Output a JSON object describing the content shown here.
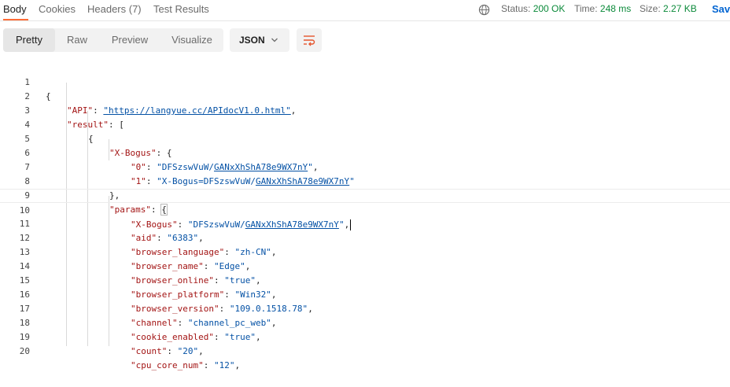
{
  "tabs": [
    {
      "label": "Body"
    },
    {
      "label": "Cookies"
    },
    {
      "label": "Headers (7)"
    },
    {
      "label": "Test Results"
    }
  ],
  "status": {
    "status_label": "Status:",
    "status_value": "200 OK",
    "time_label": "Time:",
    "time_value": "248 ms",
    "size_label": "Size:",
    "size_value": "2.27 KB",
    "save_label": "Save"
  },
  "view_modes": [
    {
      "label": "Pretty"
    },
    {
      "label": "Raw"
    },
    {
      "label": "Preview"
    },
    {
      "label": "Visualize"
    }
  ],
  "format": {
    "selected": "JSON"
  },
  "editor": {
    "line_numbers": [
      "1",
      "2",
      "3",
      "4",
      "5",
      "6",
      "7",
      "8",
      "9",
      "10",
      "11",
      "12",
      "13",
      "14",
      "15",
      "16",
      "17",
      "18",
      "19",
      "20"
    ],
    "lines": [
      "{",
      "\"API\": \"https://langyue.cc/APIdocV1.0.html\",",
      "\"result\": [",
      "{",
      "\"X-Bogus\": {",
      "\"0\": \"DFSzswVuW/GANxXhShA78e9WX7nY\",",
      "\"1\": \"X-Bogus=DFSzswVuW/GANxXhShA78e9WX7nY\"",
      "},",
      "\"params\": {",
      "\"X-Bogus\": \"DFSzswVuW/GANxXhShA78e9WX7nY\",",
      "\"aid\": \"6383\",",
      "\"browser_language\": \"zh-CN\",",
      "\"browser_name\": \"Edge\",",
      "\"browser_online\": \"true\",",
      "\"browser_platform\": \"Win32\",",
      "\"browser_version\": \"109.0.1518.78\",",
      "\"channel\": \"channel_pc_web\",",
      "\"cookie_enabled\": \"true\",",
      "\"count\": \"20\",",
      "\"cpu_core_num\": \"12\","
    ]
  },
  "colors": {
    "accent": "#ff6c37",
    "key": "#a31515",
    "string": "#0451a5",
    "success": "#0b8a3a",
    "link": "#0265d2"
  }
}
